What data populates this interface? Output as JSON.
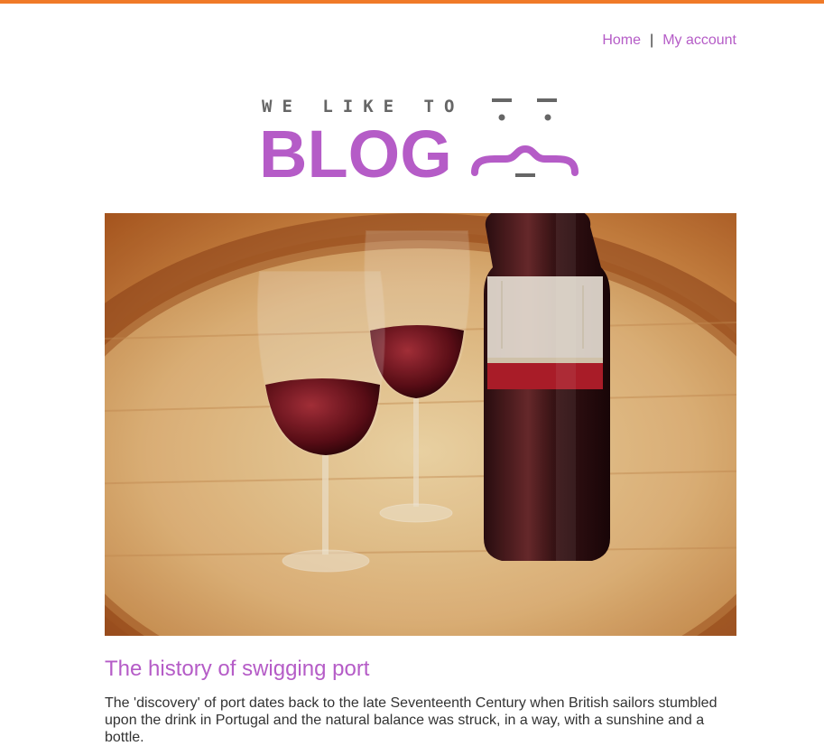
{
  "colors": {
    "accent_bar": "#f07a28",
    "brand_purple": "#b55cc7",
    "body_text": "#333333"
  },
  "nav": {
    "home_label": "Home",
    "separator": "|",
    "account_label": "My account"
  },
  "logo": {
    "tagline": "WE LIKE TO",
    "word": "BLOG"
  },
  "hero": {
    "icon": "port-wine-glasses-on-barrel-photo"
  },
  "post": {
    "title": "The history of swigging port",
    "excerpt": "The 'discovery' of port dates back to the late Seventeenth Century when British sailors stumbled upon the drink in Portugal and the natural balance was struck, in a way, with a sunshine and a bottle."
  }
}
